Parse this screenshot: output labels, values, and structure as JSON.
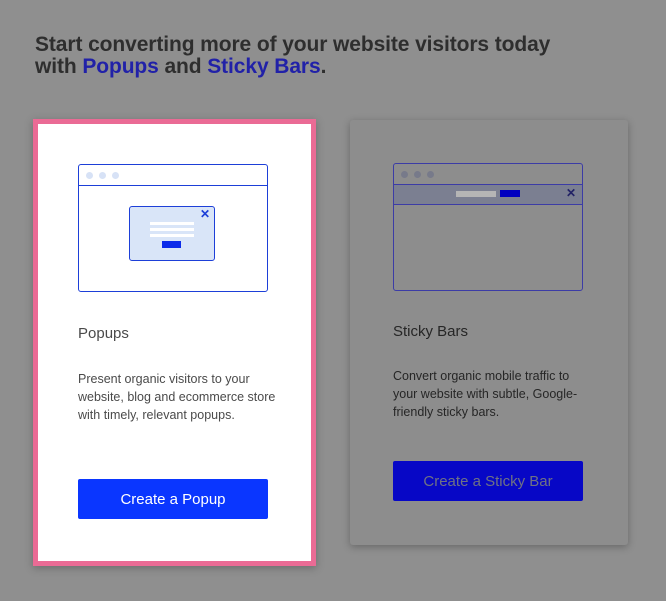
{
  "headline": {
    "prefix": "Start converting more of your website visitors today with ",
    "popups_link": "Popups",
    "middle": " and ",
    "sticky_link": "Sticky Bars",
    "suffix": "."
  },
  "cards": {
    "popups": {
      "title": "Popups",
      "description": "Present organic visitors to your website, blog and ecommerce store with timely, relevant popups.",
      "button_label": "Create a Popup",
      "selected": true
    },
    "sticky_bars": {
      "title": "Sticky Bars",
      "description": "Convert organic mobile traffic to your website with subtle, Google-friendly sticky bars.",
      "button_label": "Create a Sticky Bar"
    }
  },
  "icons": {
    "close_glyph": "✕"
  },
  "colors": {
    "accent_blue": "#0a36ff",
    "selected_border": "#ea6b95",
    "overlay": "#8f8f8f"
  }
}
